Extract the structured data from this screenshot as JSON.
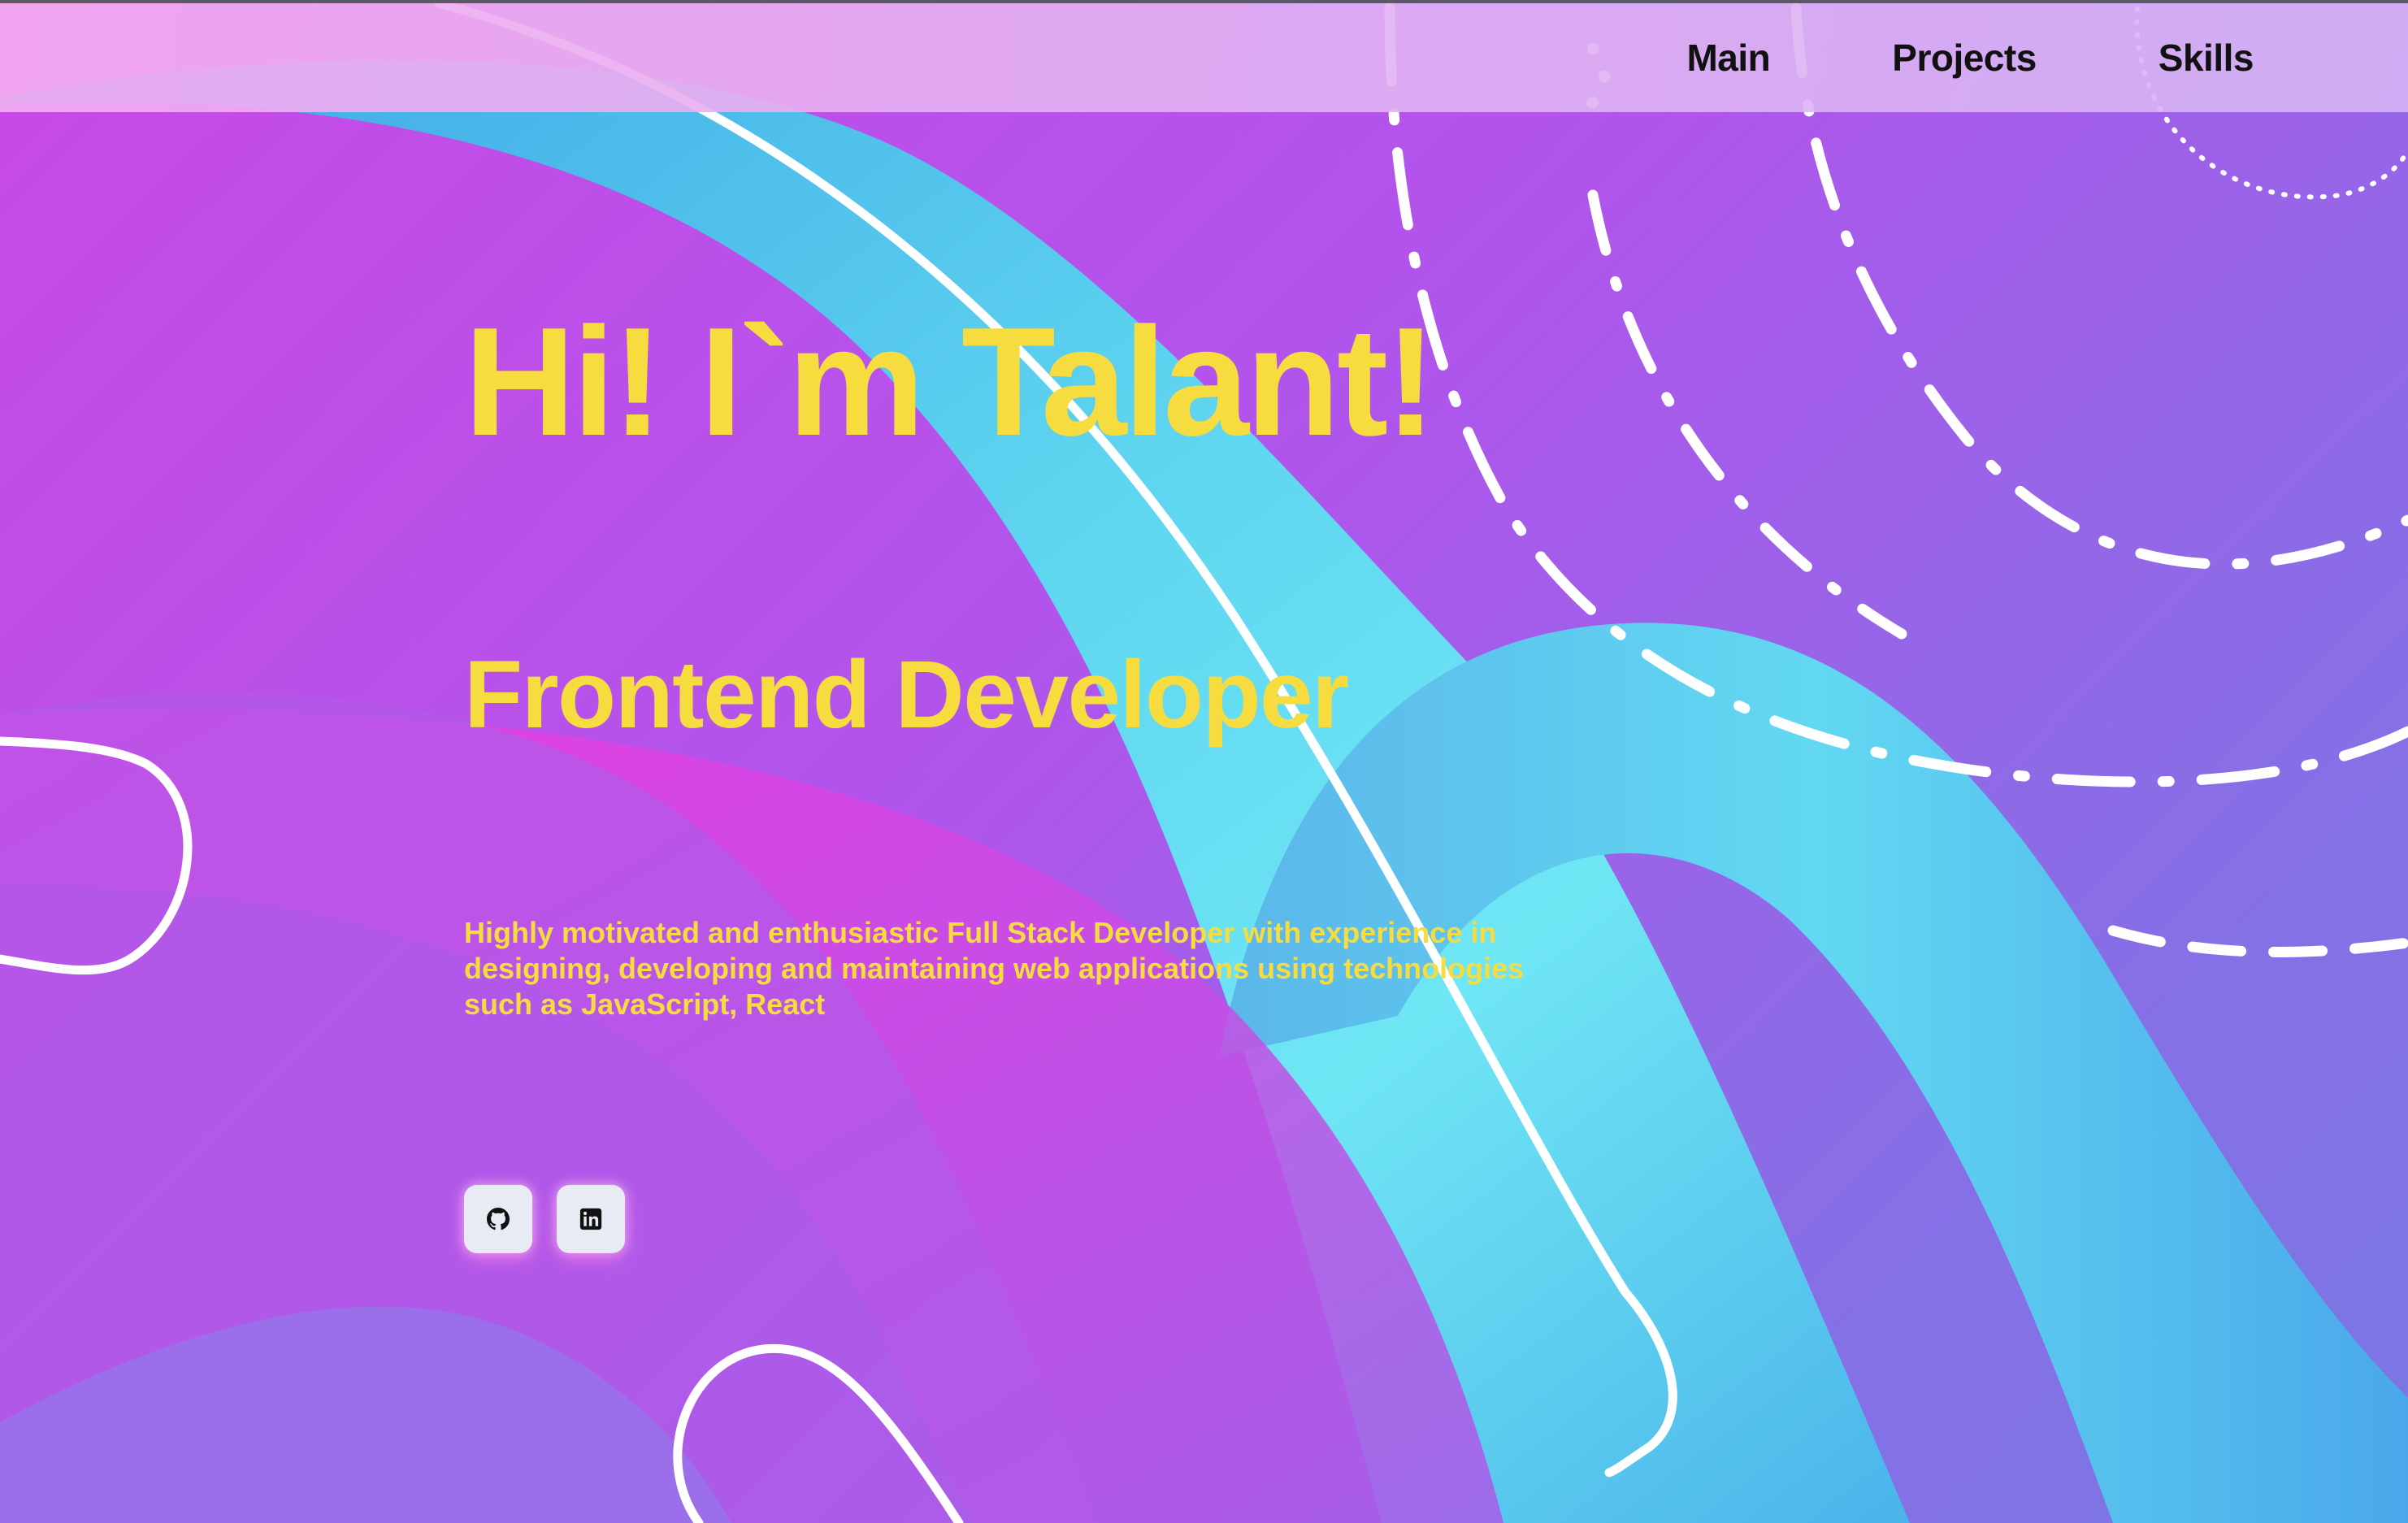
{
  "nav": {
    "items": [
      {
        "label": "Main"
      },
      {
        "label": "Projects"
      },
      {
        "label": "Skills"
      }
    ]
  },
  "hero": {
    "title": "Hi! I`m Talant!",
    "role": "Frontend Developer",
    "description": "Highly motivated and enthusiastic Full Stack Developer with experience in designing, developing and maintaining web applications using technologies such as JavaScript, React"
  },
  "socials": [
    {
      "icon": "github-icon"
    },
    {
      "icon": "linkedin-icon"
    }
  ],
  "colors": {
    "accent_text": "#f6dc3e",
    "background_purple": "#b055ec",
    "wave_cyan": "#5fd6f0",
    "wave_magenta": "#f03ae0",
    "nav_background": "#dcb4f2"
  }
}
